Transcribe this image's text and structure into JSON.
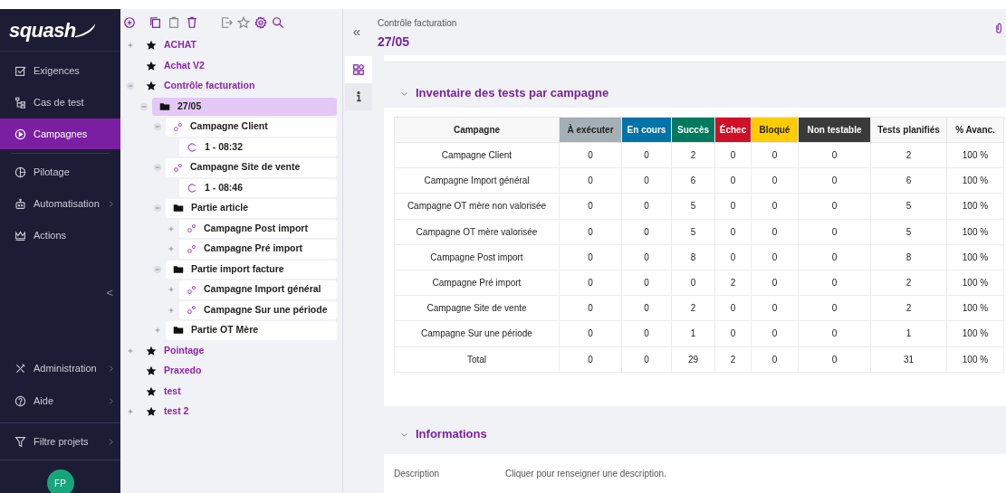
{
  "sidebar": {
    "logo": "squash",
    "items": [
      {
        "label": "Exigences",
        "selected": false,
        "submenu": false
      },
      {
        "label": "Cas de test",
        "selected": false,
        "submenu": false
      },
      {
        "label": "Campagnes",
        "selected": true,
        "submenu": false
      },
      {
        "label": "Pilotage",
        "selected": false,
        "submenu": false
      },
      {
        "label": "Automatisation",
        "selected": false,
        "submenu": true
      },
      {
        "label": "Actions",
        "selected": false,
        "submenu": false
      }
    ],
    "collapse": "<",
    "bottom_items": [
      {
        "label": "Administration",
        "selected": false,
        "submenu": true
      },
      {
        "label": "Aide",
        "selected": false,
        "submenu": true
      }
    ],
    "filter": {
      "label": "Filtre projets",
      "submenu": true
    },
    "avatar": "FP"
  },
  "tree": {
    "nodes": [
      {
        "kind": "project",
        "label": "ACHAT",
        "expanded": false,
        "selected": false
      },
      {
        "kind": "project",
        "label": "Achat V2",
        "selected": false
      },
      {
        "kind": "project",
        "label": "Contrôle facturation",
        "expanded": true,
        "selected": false,
        "children": [
          {
            "kind": "folder",
            "label": "27/05",
            "expanded": true,
            "selected": true,
            "children": [
              {
                "kind": "campaign",
                "label": "Campagne Client",
                "expanded": true,
                "selected": false,
                "children": [
                  {
                    "kind": "iteration",
                    "label": "1 - 08:32",
                    "selected": false
                  }
                ]
              },
              {
                "kind": "campaign",
                "label": "Campagne Site de vente",
                "expanded": true,
                "selected": false,
                "children": [
                  {
                    "kind": "iteration",
                    "label": "1 - 08:46",
                    "selected": false
                  }
                ]
              },
              {
                "kind": "folder",
                "label": "Partie article",
                "expanded": true,
                "selected": false,
                "children": [
                  {
                    "kind": "campaign",
                    "label": "Campagne Post import",
                    "expanded": false,
                    "selected": false
                  },
                  {
                    "kind": "campaign",
                    "label": "Campagne Pré import",
                    "expanded": false,
                    "selected": false
                  }
                ]
              },
              {
                "kind": "folder",
                "label": "Partie import facture",
                "expanded": true,
                "selected": false,
                "children": [
                  {
                    "kind": "campaign",
                    "label": "Campagne Import général",
                    "expanded": false,
                    "selected": false
                  },
                  {
                    "kind": "campaign",
                    "label": "Campagne Sur une période",
                    "expanded": false,
                    "selected": false
                  }
                ]
              },
              {
                "kind": "folder",
                "label": "Partie OT Mère",
                "expanded": false,
                "selected": false
              }
            ]
          }
        ]
      },
      {
        "kind": "project",
        "label": "Pointage",
        "expanded": false,
        "selected": false
      },
      {
        "kind": "project",
        "label": "Praxedo",
        "selected": false
      },
      {
        "kind": "project",
        "label": "test",
        "selected": false
      },
      {
        "kind": "project",
        "label": "test 2",
        "expanded": false,
        "selected": false
      }
    ]
  },
  "header": {
    "collapse": "«",
    "breadcrumb": "Contrôle facturation",
    "title": "27/05"
  },
  "side_tabs": [
    {
      "selected": true
    },
    {
      "selected": false
    }
  ],
  "inventory": {
    "title": "Inventaire des tests par campagne",
    "columns": [
      {
        "label": "Campagne",
        "color": "#f8f8f8"
      },
      {
        "label": "À exécuter",
        "color": "#a4b0b6"
      },
      {
        "label": "En cours",
        "color": "#0073a8"
      },
      {
        "label": "Succès",
        "color": "#007a5e"
      },
      {
        "label": "Échec",
        "color": "#ce1126"
      },
      {
        "label": "Bloqué",
        "color": "#ffcc00"
      },
      {
        "label": "Non testable",
        "color": "#3a3a3a"
      },
      {
        "label": "Tests planifiés",
        "color": "#f8f8f8"
      },
      {
        "label": "% Avanc.",
        "color": "#f8f8f8"
      }
    ],
    "rows": [
      [
        "Campagne Client",
        "0",
        "0",
        "2",
        "0",
        "0",
        "0",
        "2",
        "100 %"
      ],
      [
        "Campagne Import général",
        "0",
        "0",
        "6",
        "0",
        "0",
        "0",
        "6",
        "100 %"
      ],
      [
        "Campagne OT mère non valorisée",
        "0",
        "0",
        "5",
        "0",
        "0",
        "0",
        "5",
        "100 %"
      ],
      [
        "Campagne OT mère valorisée",
        "0",
        "0",
        "5",
        "0",
        "0",
        "0",
        "5",
        "100 %"
      ],
      [
        "Campagne Post import",
        "0",
        "0",
        "8",
        "0",
        "0",
        "0",
        "8",
        "100 %"
      ],
      [
        "Campagne Pré import",
        "0",
        "0",
        "0",
        "2",
        "0",
        "0",
        "2",
        "100 %"
      ],
      [
        "Campagne Site de vente",
        "0",
        "0",
        "2",
        "0",
        "0",
        "0",
        "2",
        "100 %"
      ],
      [
        "Campagne Sur une période",
        "0",
        "0",
        "1",
        "0",
        "0",
        "0",
        "1",
        "100 %"
      ],
      [
        "Total",
        "0",
        "0",
        "29",
        "2",
        "0",
        "0",
        "31",
        "100 %"
      ]
    ]
  },
  "informations": {
    "title": "Informations",
    "fields": [
      {
        "label": "Description",
        "value": "Cliquer pour renseigner une description."
      }
    ]
  }
}
